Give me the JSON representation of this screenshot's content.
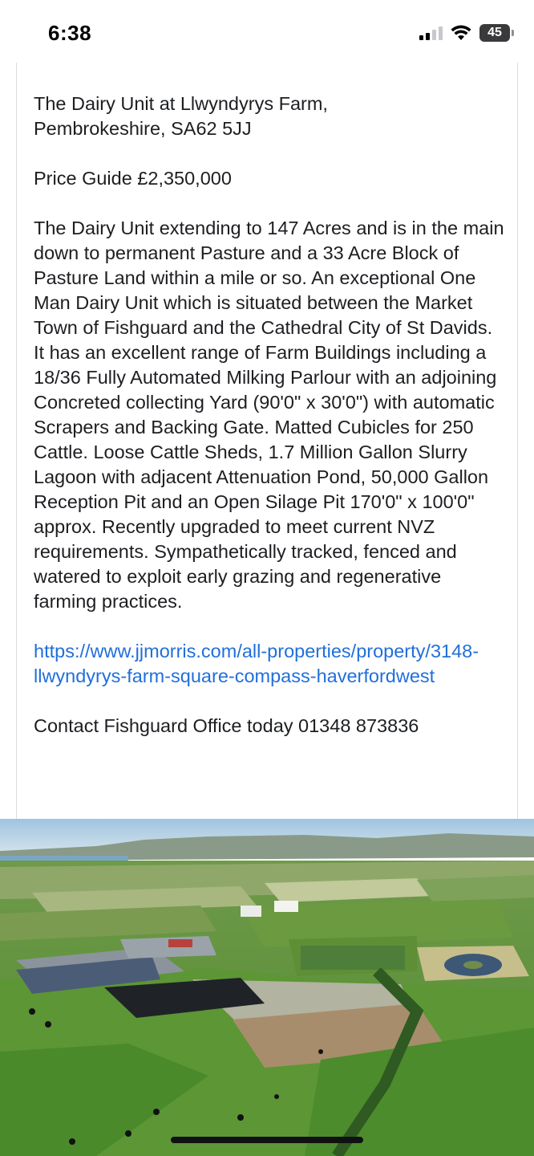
{
  "status_bar": {
    "time": "6:38",
    "battery": "45",
    "icons": [
      "signal-icon",
      "wifi-icon",
      "battery-icon"
    ]
  },
  "post": {
    "address_line1": "The Dairy Unit at Llwyndyrys Farm,",
    "address_line2": "Pembrokeshire, SA62 5JJ",
    "price": "Price Guide £2,350,000",
    "description": "The Dairy Unit extending to 147 Acres and is in the main down to permanent Pasture and a 33 Acre Block of Pasture Land within a mile or so. An exceptional One Man Dairy Unit which is situated between the Market Town of Fishguard and the Cathedral City of St Davids. It has an excellent range of Farm Buildings including a 18/36 Fully Automated Milking Parlour with an adjoining Concreted collecting Yard (90'0\" x 30'0\") with automatic Scrapers and Backing Gate. Matted Cubicles for 250 Cattle. Loose Cattle Sheds, 1.7 Million Gallon Slurry Lagoon with adjacent Attenuation Pond, 50,000 Gallon Reception Pit and an Open Silage Pit 170'0\" x 100'0\" approx. Recently upgraded to meet current NVZ requirements. Sympathetically tracked, fenced and watered to exploit early grazing and regenerative farming practices.",
    "link": "https://www.jjmorris.com/all-properties/property/3148-llwyndyrys-farm-square-compass-haverfordwest",
    "contact": "Contact Fishguard Office today 01348 873836"
  },
  "colors": {
    "link": "#216fdb",
    "text": "#1c1e21",
    "card_border": "#dadde1"
  }
}
